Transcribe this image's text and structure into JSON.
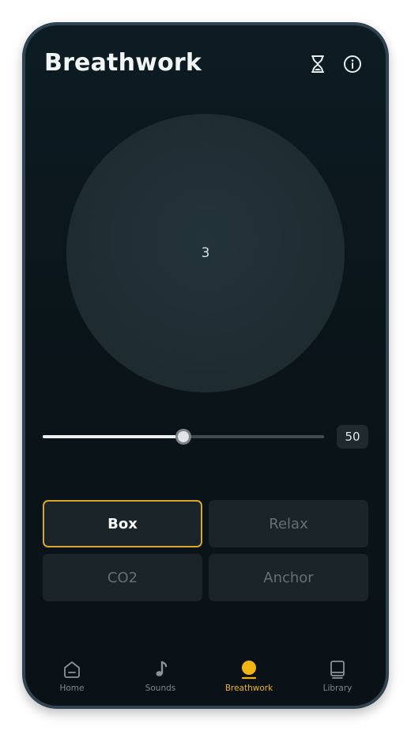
{
  "header": {
    "title": "Breathwork",
    "icons": [
      "hourglass-icon",
      "info-icon"
    ]
  },
  "breath": {
    "count": "3"
  },
  "slider": {
    "value": 50,
    "max": 100,
    "value_label": "50"
  },
  "patterns": [
    {
      "label": "Box",
      "selected": true
    },
    {
      "label": "Relax",
      "selected": false
    },
    {
      "label": "CO2",
      "selected": false
    },
    {
      "label": "Anchor",
      "selected": false
    }
  ],
  "tabs": [
    {
      "label": "Home",
      "icon": "home-icon",
      "active": false
    },
    {
      "label": "Sounds",
      "icon": "music-note-icon",
      "active": false
    },
    {
      "label": "Breathwork",
      "icon": "breath-dot-icon",
      "active": true
    },
    {
      "label": "Library",
      "icon": "book-icon",
      "active": false
    }
  ],
  "colors": {
    "accent": "#f0b415",
    "selected_border": "#d9a62c",
    "background": "#0b161b"
  }
}
